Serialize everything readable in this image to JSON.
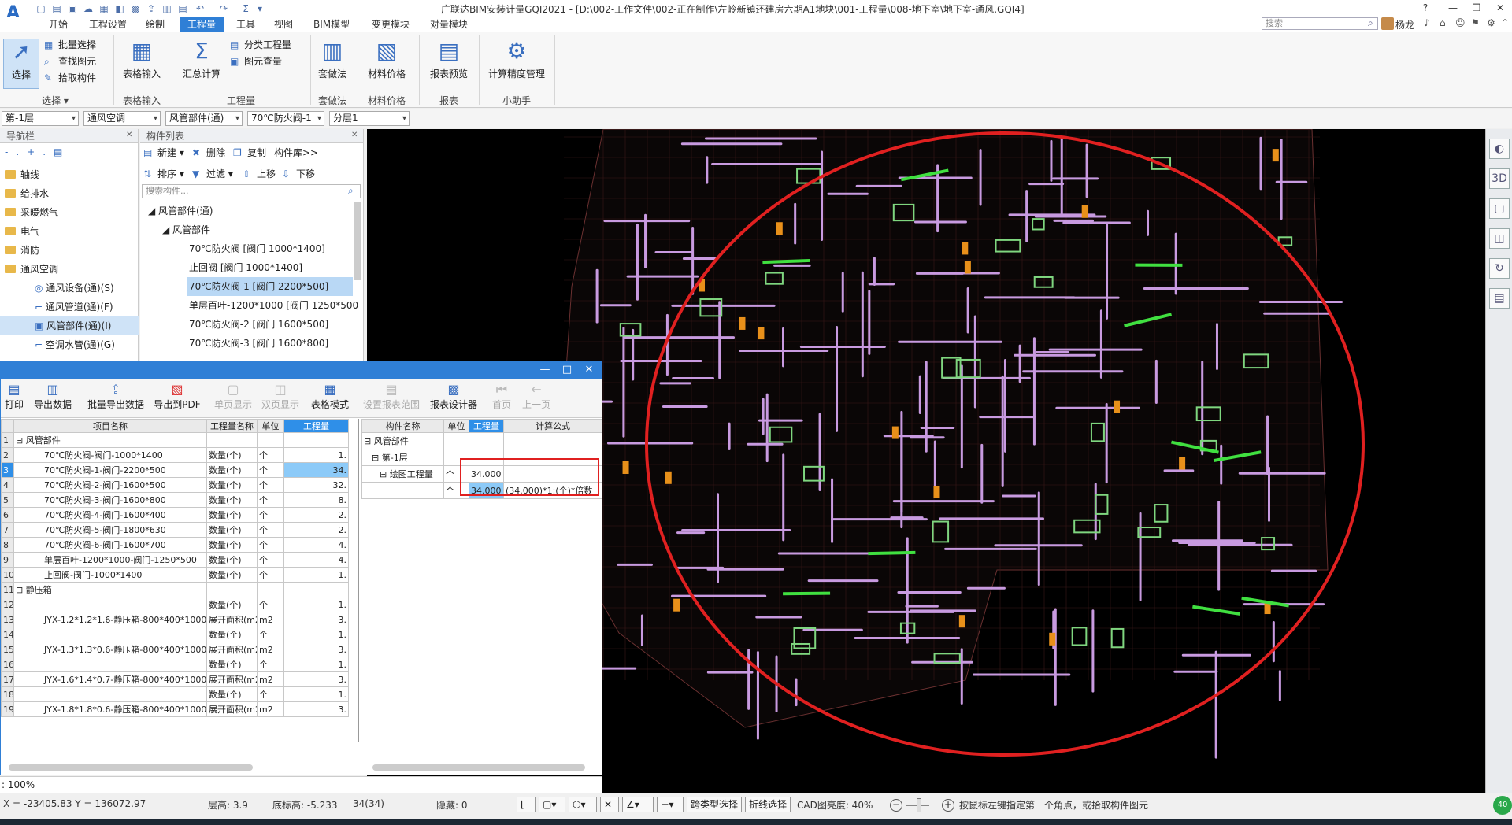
{
  "app": {
    "title": "广联达BIM安装计量GQI2021 - [D:\\002-工作文件\\002-正在制作\\左岭新镇还建房六期A1地块\\001-工程量\\008-地下室\\地下室-通风.GQI4]"
  },
  "menu": {
    "items": [
      "开始",
      "工程设置",
      "绘制",
      "工程量",
      "工具",
      "视图",
      "BIM模型",
      "变更模块",
      "对量模块"
    ],
    "active": "工程量"
  },
  "search": {
    "placeholder": "搜索"
  },
  "user": {
    "name": "杨龙"
  },
  "ribbon": {
    "select": "选择",
    "batch_select": "批量选择",
    "find_element": "查找图元",
    "pick_component": "拾取构件",
    "table_input": "表格输入",
    "sum_calc": "汇总计算",
    "class_qty": "分类工程量",
    "element_qty": "图元查量",
    "method": "套做法",
    "material_price": "材料价格",
    "report_preview": "报表预览",
    "precision": "计算精度管理",
    "groups": {
      "select": "选择",
      "table_input": "表格输入",
      "quantity": "工程量",
      "method": "套做法",
      "material": "材料价格",
      "report": "报表",
      "assistant": "小助手"
    }
  },
  "selectors": {
    "floor": "第-1层",
    "system": "通风空调",
    "type": "风管部件(通)",
    "component": "70℃防火阀-1",
    "layer": "分层1"
  },
  "nav": {
    "title": "导航栏",
    "items": [
      {
        "label": "轴线"
      },
      {
        "label": "给排水"
      },
      {
        "label": "采暖燃气"
      },
      {
        "label": "电气"
      },
      {
        "label": "消防"
      },
      {
        "label": "通风空调"
      }
    ],
    "sub": [
      "通风设备(通)(S)",
      "通风管道(通)(F)",
      "风管部件(通)(I)",
      "空调水管(通)(G)"
    ]
  },
  "complist": {
    "title": "构件列表",
    "new": "新建",
    "delete": "删除",
    "copy": "复制",
    "library": "构件库>>",
    "sort": "排序",
    "filter": "过滤",
    "up": "上移",
    "down": "下移",
    "search_placeholder": "搜索构件...",
    "root": "风管部件(通)",
    "group": "风管部件",
    "items": [
      "70℃防火阀 [阀门 1000*1400]",
      "止回阀 [阀门 1000*1400]",
      "70℃防火阀-1 [阀门 2200*500]",
      "单层百叶-1200*1000 [阀门 1250*500",
      "70℃防火阀-2 [阀门 1600*500]",
      "70℃防火阀-3 [阀门 1600*800]"
    ]
  },
  "report": {
    "toolbar": {
      "print": "打印",
      "export": "导出数据",
      "batch_export": "批量导出数据",
      "export_pdf": "导出到PDF",
      "single_page": "单页显示",
      "double_page": "双页显示",
      "table_mode": "表格模式",
      "set_range": "设置报表范围",
      "designer": "报表设计器",
      "first": "首页",
      "prev": "上一页"
    },
    "left_headers": [
      "项目名称",
      "工程量名称",
      "单位",
      "工程量"
    ],
    "rows": [
      {
        "n": "1",
        "name": "风管部件",
        "qn": "",
        "u": "",
        "v": ""
      },
      {
        "n": "2",
        "name": "70℃防火阀-阀门-1000*1400",
        "qn": "数量(个)",
        "u": "个",
        "v": "1."
      },
      {
        "n": "3",
        "name": "70℃防火阀-1-阀门-2200*500",
        "qn": "数量(个)",
        "u": "个",
        "v": "34."
      },
      {
        "n": "4",
        "name": "70℃防火阀-2-阀门-1600*500",
        "qn": "数量(个)",
        "u": "个",
        "v": "32."
      },
      {
        "n": "5",
        "name": "70℃防火阀-3-阀门-1600*800",
        "qn": "数量(个)",
        "u": "个",
        "v": "8."
      },
      {
        "n": "6",
        "name": "70℃防火阀-4-阀门-1600*400",
        "qn": "数量(个)",
        "u": "个",
        "v": "2."
      },
      {
        "n": "7",
        "name": "70℃防火阀-5-阀门-1800*630",
        "qn": "数量(个)",
        "u": "个",
        "v": "2."
      },
      {
        "n": "8",
        "name": "70℃防火阀-6-阀门-1600*700",
        "qn": "数量(个)",
        "u": "个",
        "v": "4."
      },
      {
        "n": "9",
        "name": "单层百叶-1200*1000-阀门-1250*500",
        "qn": "数量(个)",
        "u": "个",
        "v": "4."
      },
      {
        "n": "10",
        "name": "止回阀-阀门-1000*1400",
        "qn": "数量(个)",
        "u": "个",
        "v": "1."
      },
      {
        "n": "11",
        "name": "静压箱",
        "qn": "",
        "u": "",
        "v": ""
      },
      {
        "n": "12",
        "name": "",
        "qn": "数量(个)",
        "u": "个",
        "v": "1."
      },
      {
        "n": "13",
        "name": "JYX-1.2*1.2*1.6-静压箱-800*400*1000",
        "qn": "展开面积(m2)",
        "u": "m2",
        "v": "3."
      },
      {
        "n": "14",
        "name": "",
        "qn": "数量(个)",
        "u": "个",
        "v": "1."
      },
      {
        "n": "15",
        "name": "JYX-1.3*1.3*0.6-静压箱-800*400*1000",
        "qn": "展开面积(m2)",
        "u": "m2",
        "v": "3."
      },
      {
        "n": "16",
        "name": "",
        "qn": "数量(个)",
        "u": "个",
        "v": "1."
      },
      {
        "n": "17",
        "name": "JYX-1.6*1.4*0.7-静压箱-800*400*1000",
        "qn": "展开面积(m2)",
        "u": "m2",
        "v": "3."
      },
      {
        "n": "18",
        "name": "",
        "qn": "数量(个)",
        "u": "个",
        "v": "1."
      },
      {
        "n": "19",
        "name": "JYX-1.8*1.8*0.6-静压箱-800*400*1000",
        "qn": "展开面积(m2)",
        "u": "m2",
        "v": "3."
      }
    ],
    "right_headers": [
      "构件名称",
      "单位",
      "工程量",
      "计算公式"
    ],
    "right_rows": [
      {
        "name": "风管部件",
        "u": "",
        "v": "",
        "f": ""
      },
      {
        "name": "第-1层",
        "u": "",
        "v": "",
        "f": ""
      },
      {
        "name": "绘图工程量",
        "u": "个",
        "v": "34.000",
        "f": ""
      },
      {
        "name": "",
        "u": "个",
        "v": "34.000",
        "f": "(34.000)*1:(个)*倍数"
      }
    ],
    "zoom": "100%"
  },
  "status": {
    "coords": "X = -23405.83 Y = 136072.97",
    "floor_height": "层高: 3.9",
    "bottom_elev": "底标高: -5.233",
    "count": "34(34)",
    "hidden": "隐藏: 0",
    "cross_type": "跨类型选择",
    "polyline": "折线选择",
    "cad_brightness": "CAD图亮度: 40%",
    "hint": "按鼠标左键指定第一个角点，或拾取构件图元"
  },
  "colors": {
    "accent": "#2f7fd6",
    "highlight": "#8ccaf8",
    "annotation": "#e02020"
  }
}
